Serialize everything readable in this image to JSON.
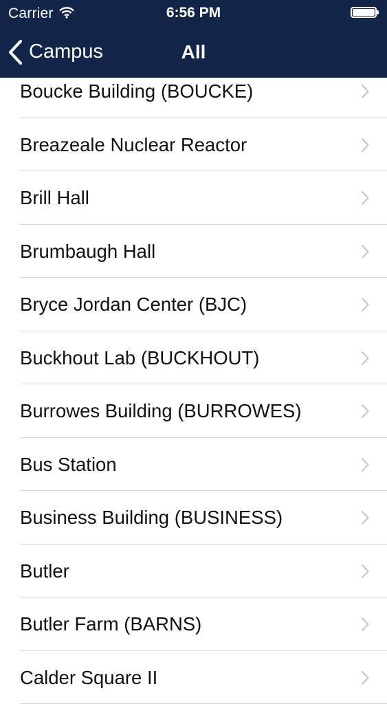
{
  "status_bar": {
    "carrier": "Carrier",
    "time": "6:56 PM",
    "wifi_icon": "wifi-icon",
    "battery_icon": "battery-icon"
  },
  "nav_bar": {
    "back_label": "Campus",
    "back_icon": "chevron-left-icon",
    "title": "All"
  },
  "colors": {
    "nav_background": "#13264a",
    "row_divider": "#d7d7d7",
    "chevron": "#c7c7cc"
  },
  "list": {
    "items": [
      {
        "label": "Boucke Building (BOUCKE)"
      },
      {
        "label": "Breazeale Nuclear Reactor"
      },
      {
        "label": "Brill Hall"
      },
      {
        "label": "Brumbaugh Hall"
      },
      {
        "label": "Bryce Jordan Center (BJC)"
      },
      {
        "label": "Buckhout Lab (BUCKHOUT)"
      },
      {
        "label": "Burrowes Building (BURROWES)"
      },
      {
        "label": "Bus Station"
      },
      {
        "label": "Business Building (BUSINESS)"
      },
      {
        "label": "Butler"
      },
      {
        "label": "Butler Farm (BARNS)"
      },
      {
        "label": "Calder Square II"
      }
    ]
  }
}
